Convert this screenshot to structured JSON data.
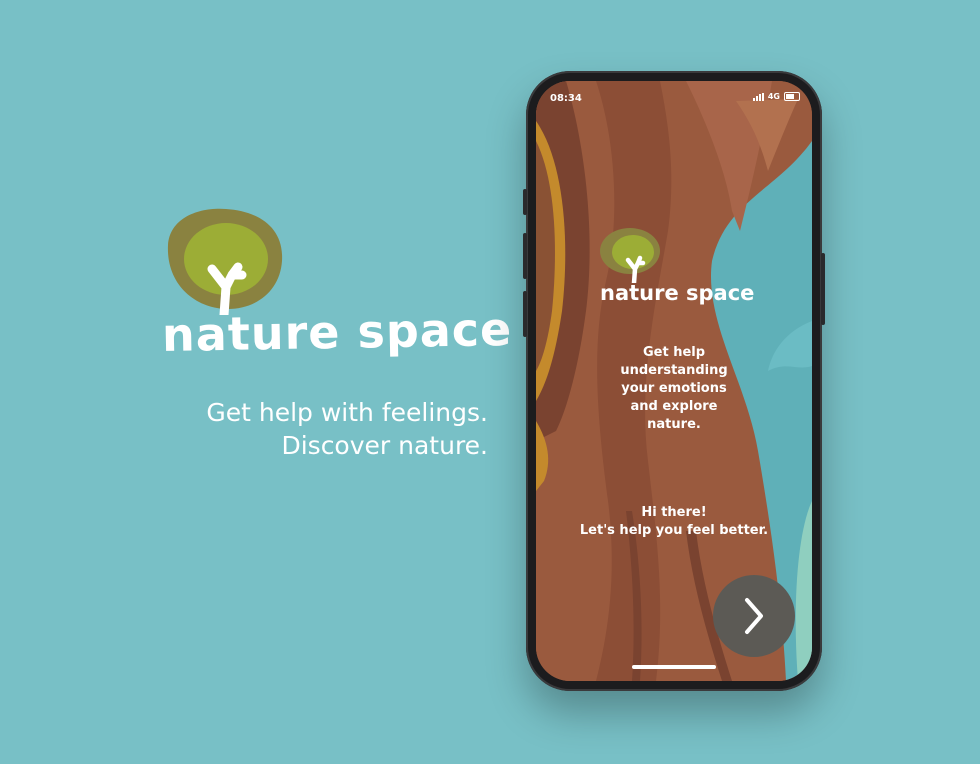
{
  "brand": {
    "name": "nature space",
    "tagline_line1": "Get help with feelings.",
    "tagline_line2": "Discover nature."
  },
  "phone": {
    "status_bar": {
      "time": "08:34",
      "network": "4G"
    },
    "app_name": "nature space",
    "intro_text": "Get help\nunderstanding\nyour emotions\nand explore\nnature.",
    "greeting_line1": "Hi there!",
    "greeting_line2": "Let's help you feel better.",
    "next_icon": "chevron-right-icon"
  },
  "colors": {
    "background": "#78c0c6",
    "trunk": "#9a5a3e",
    "sky": "#5fb0b8",
    "logo_outer": "#8a8240",
    "logo_inner": "#9cad36",
    "button": "#5c5a55"
  }
}
